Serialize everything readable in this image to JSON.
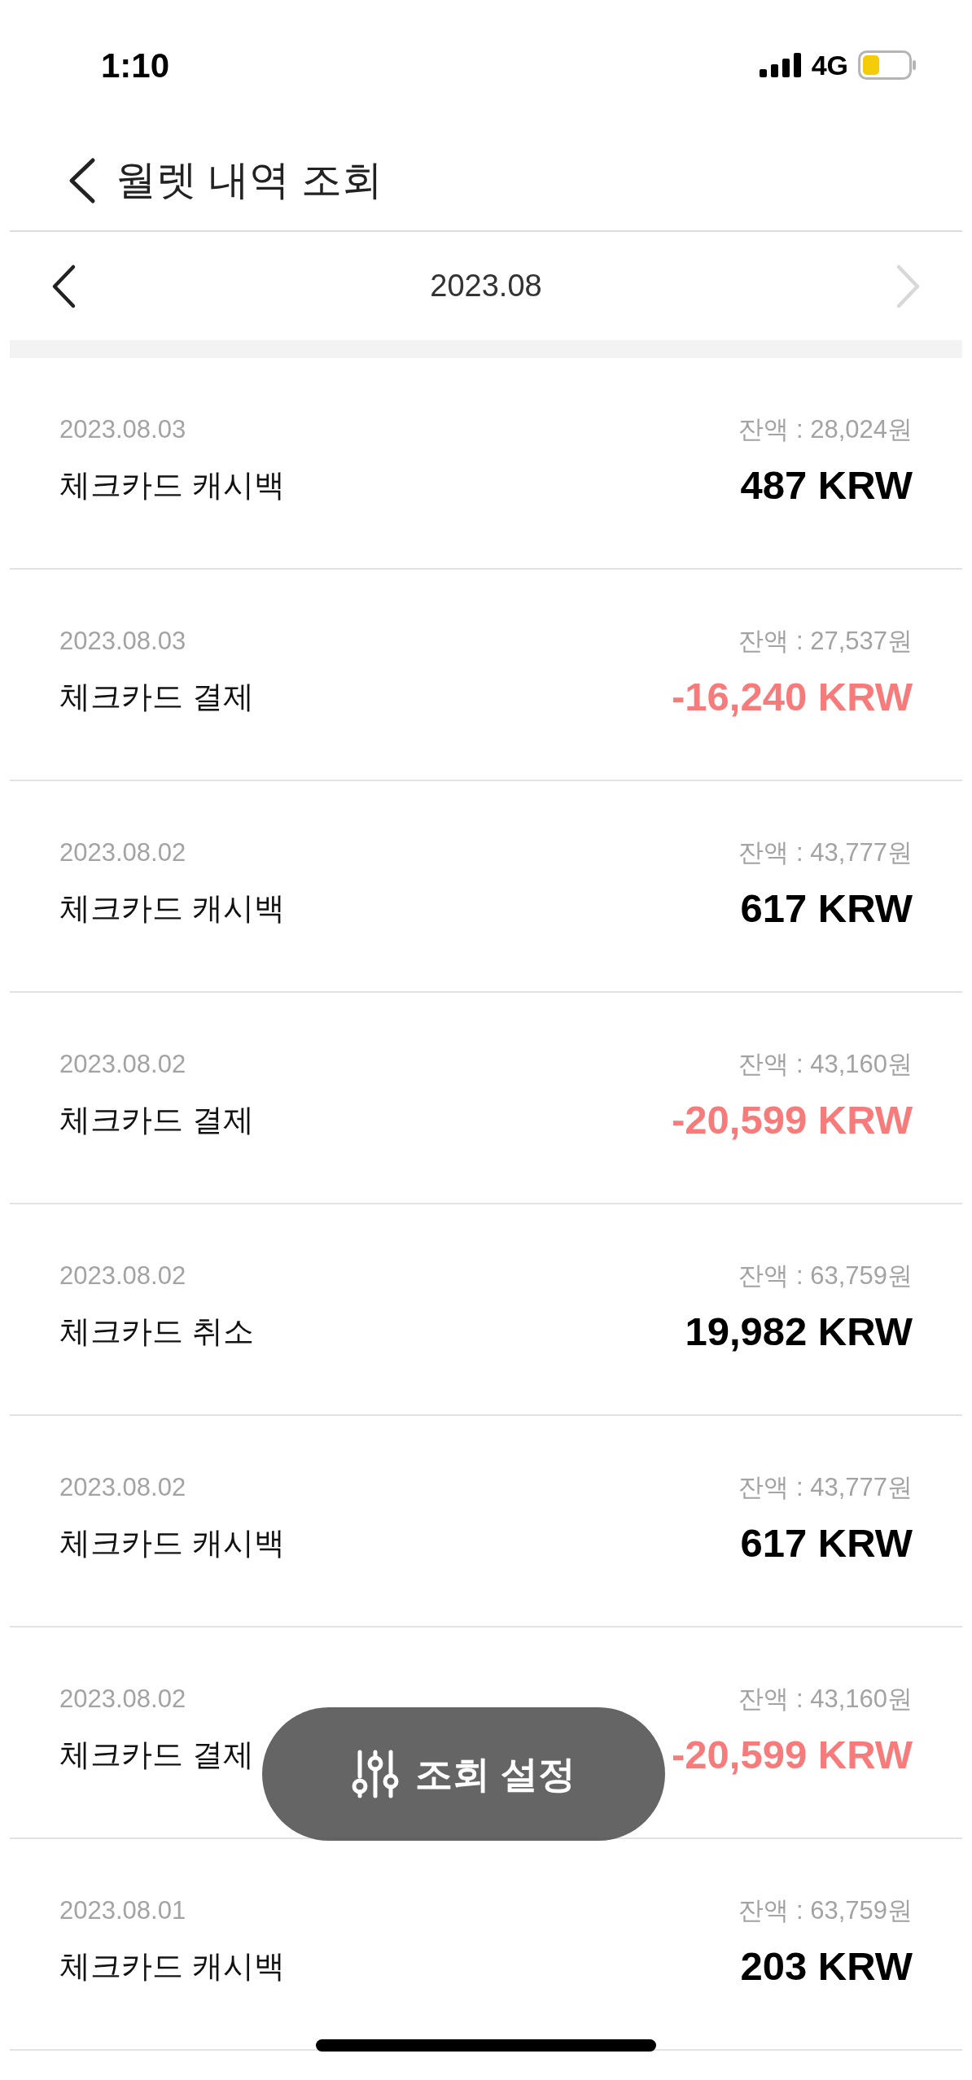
{
  "status_bar": {
    "time": "1:10",
    "network": "4G"
  },
  "header": {
    "title": "월렛 내역 조회"
  },
  "month_nav": {
    "label": "2023.08",
    "next_disabled": true
  },
  "transactions": [
    {
      "date": "2023.08.03",
      "balance": "잔액 : 28,024원",
      "title": "체크카드 캐시백",
      "amount": "487 KRW",
      "kind": "credit"
    },
    {
      "date": "2023.08.03",
      "balance": "잔액 : 27,537원",
      "title": "체크카드 결제",
      "amount": "-16,240 KRW",
      "kind": "debit"
    },
    {
      "date": "2023.08.02",
      "balance": "잔액 : 43,777원",
      "title": "체크카드 캐시백",
      "amount": "617 KRW",
      "kind": "credit"
    },
    {
      "date": "2023.08.02",
      "balance": "잔액 : 43,160원",
      "title": "체크카드 결제",
      "amount": "-20,599 KRW",
      "kind": "debit"
    },
    {
      "date": "2023.08.02",
      "balance": "잔액 : 63,759원",
      "title": "체크카드 취소",
      "amount": "19,982 KRW",
      "kind": "credit"
    },
    {
      "date": "2023.08.02",
      "balance": "잔액 : 43,777원",
      "title": "체크카드 캐시백",
      "amount": "617 KRW",
      "kind": "credit"
    },
    {
      "date": "2023.08.02",
      "balance": "잔액 : 43,160원",
      "title": "체크카드 결제",
      "amount": "-20,599 KRW",
      "kind": "debit"
    },
    {
      "date": "2023.08.01",
      "balance": "잔액 : 63,759원",
      "title": "체크카드 캐시백",
      "amount": "203 KRW",
      "kind": "credit"
    }
  ],
  "filter_button": {
    "label": "조회 설정"
  }
}
